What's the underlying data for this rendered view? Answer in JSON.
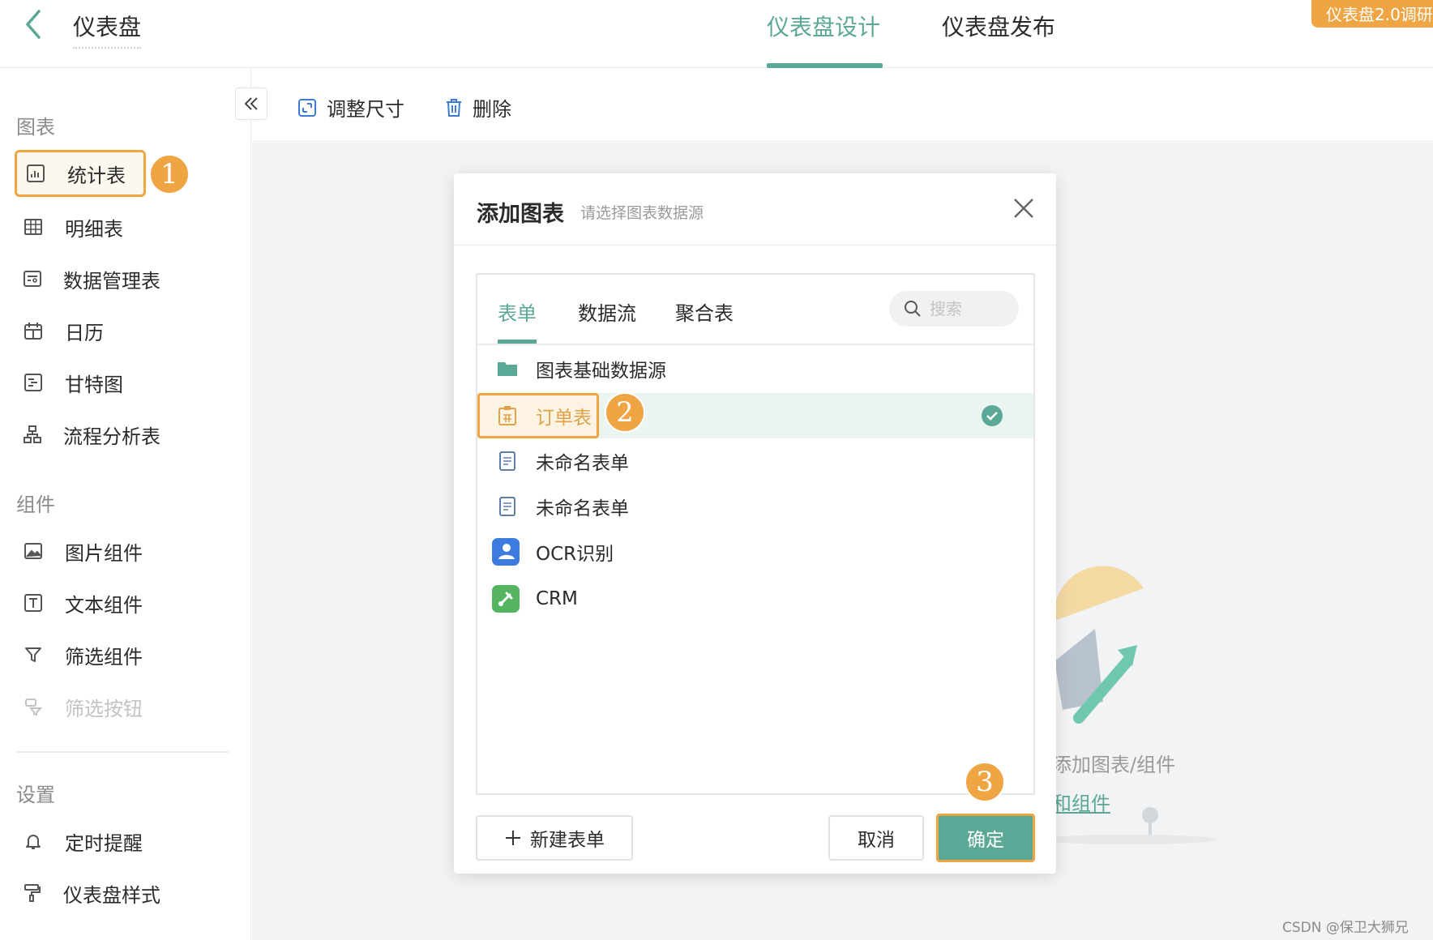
{
  "header": {
    "title": "仪表盘",
    "tabs": [
      {
        "label": "仪表盘设计",
        "active": true
      },
      {
        "label": "仪表盘发布",
        "active": false
      }
    ],
    "corner_badge": "仪表盘2.0调研"
  },
  "sidebar": {
    "sections": [
      {
        "title": "图表",
        "items": [
          {
            "label": "统计表",
            "icon": "bar-chart-icon",
            "highlighted": true
          },
          {
            "label": "明细表",
            "icon": "grid-table-icon"
          },
          {
            "label": "数据管理表",
            "icon": "data-table-icon"
          },
          {
            "label": "日历",
            "icon": "calendar-icon"
          },
          {
            "label": "甘特图",
            "icon": "gantt-icon"
          },
          {
            "label": "流程分析表",
            "icon": "flow-icon"
          }
        ]
      },
      {
        "title": "组件",
        "items": [
          {
            "label": "图片组件",
            "icon": "image-icon"
          },
          {
            "label": "文本组件",
            "icon": "text-icon"
          },
          {
            "label": "筛选组件",
            "icon": "filter-icon"
          },
          {
            "label": "筛选按钮",
            "icon": "filter-button-icon",
            "disabled": true
          }
        ]
      },
      {
        "title": "设置",
        "items": [
          {
            "label": "定时提醒",
            "icon": "bell-icon"
          },
          {
            "label": "仪表盘样式",
            "icon": "paint-roller-icon"
          }
        ]
      }
    ]
  },
  "steps": [
    "1",
    "2",
    "3"
  ],
  "toolbar": {
    "resize_label": "调整尺寸",
    "delete_label": "删除"
  },
  "canvas": {
    "empty_hint": "添加图表/组件",
    "empty_link": "和组件"
  },
  "modal": {
    "title": "添加图表",
    "subtitle": "请选择图表数据源",
    "tabs": [
      {
        "label": "表单",
        "active": true
      },
      {
        "label": "数据流",
        "active": false
      },
      {
        "label": "聚合表",
        "active": false
      }
    ],
    "search_placeholder": "搜索",
    "items": [
      {
        "label": "图表基础数据源",
        "icon": "folder-icon"
      },
      {
        "label": "订单表",
        "icon": "form-icon",
        "selected": true
      },
      {
        "label": "未命名表单",
        "icon": "document-icon"
      },
      {
        "label": "未命名表单",
        "icon": "document-icon"
      },
      {
        "label": "OCR识别",
        "icon": "ocr-app-icon"
      },
      {
        "label": "CRM",
        "icon": "crm-app-icon"
      }
    ],
    "new_form_label": "新建表单",
    "cancel_label": "取消",
    "confirm_label": "确定"
  },
  "watermark": "CSDN @保卫大狮兄",
  "colors": {
    "accent": "#5ba896",
    "highlight": "#f0a544",
    "canvas_bg": "#f2f3f4"
  }
}
